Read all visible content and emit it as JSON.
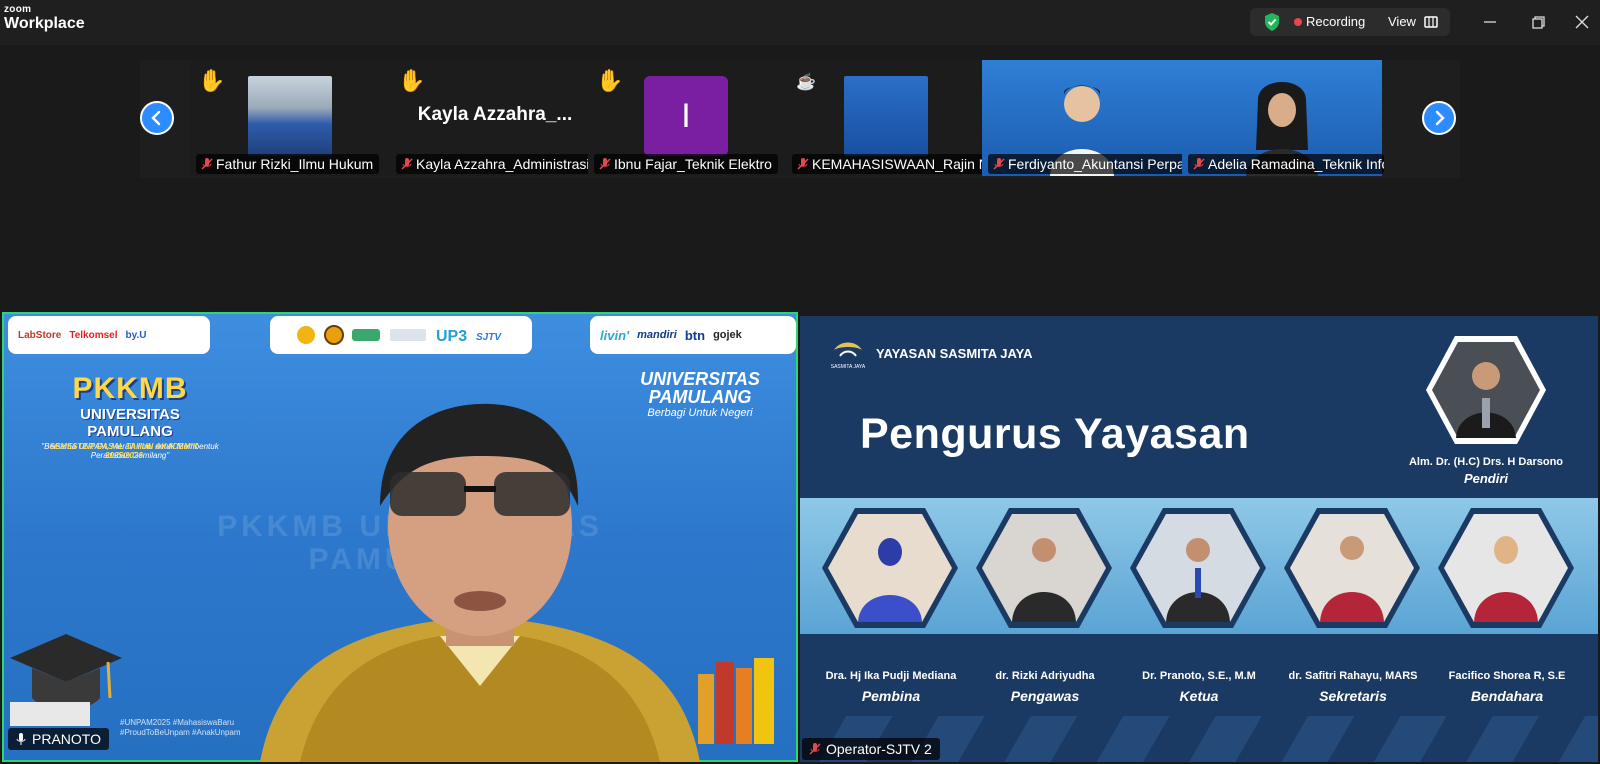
{
  "app": {
    "brand_small": "zoom",
    "brand_large": "Workplace",
    "recording_label": "Recording",
    "view_label": "View"
  },
  "colors": {
    "accent": "#2d8cff",
    "recording": "#e5484d",
    "active_speaker": "#2ed573",
    "raised_hand": "#f5c542",
    "avatar_purple": "#7b1fa2"
  },
  "participants": [
    {
      "name": "Fathur Rizki_Ilmu Hukum",
      "status_icon": "raised-hand-icon",
      "tile_type": "photo"
    },
    {
      "name": "Kayla Azzahra_Administrasi ...",
      "display": "Kayla  Azzahra_...",
      "status_icon": "raised-hand-icon",
      "tile_type": "name"
    },
    {
      "name": "Ibnu Fajar_Teknik Elektro",
      "initial": "I",
      "status_icon": "raised-hand-icon",
      "tile_type": "initial"
    },
    {
      "name": "KEMAHASISWAAN_Rajin Na...",
      "status_icon": "coffee-icon",
      "tile_type": "slide"
    },
    {
      "name": "Ferdiyanto_Akuntansi Perpaj...",
      "tile_type": "video"
    },
    {
      "name": "Adelia Ramadina_Teknik Info...",
      "tile_type": "video"
    }
  ],
  "main_left": {
    "participant": "PRANOTO",
    "sponsors_left": [
      "LabStore",
      "Telkomsel",
      "by.U"
    ],
    "sponsors_right": [
      "livin'",
      "mandiri",
      "btn",
      "gojek"
    ],
    "pkkmb_title": "PKKMB",
    "pkkmb_university": "UNIVERSITAS PAMULANG",
    "pkkmb_tagline": "\"Bersama UNPAM, Meraih Ilmu untuk Membentuk Peradaban Gemilang\"",
    "semester": "SEMESTER GASAL TAHUN AKADEMIK 2025/2026",
    "brand_title": "UNIVERSITAS PAMULANG",
    "brand_tagline": "Berbagi Untuk Negeri",
    "watermark": "PKKMB UNIVERSITAS PAMULANG",
    "hashtags": "#UNPAM2025 #MahasiswaBaru #ProudToBeUnpam #AnakUnpam"
  },
  "main_right": {
    "participant": "Operator-SJTV 2",
    "org_name": "YAYASAN SASMITA JAYA",
    "org_logo_caption": "SASMITA JAYA",
    "slide_title": "Pengurus Yayasan",
    "founder": {
      "name": "Alm. Dr. (H.C) Drs. H Darsono",
      "role": "Pendiri"
    },
    "members": [
      {
        "name": "Dra. Hj Ika Pudji Mediana",
        "role": "Pembina",
        "color": "#3a4fc9"
      },
      {
        "name": "dr. Rizki Adriyudha",
        "role": "Pengawas",
        "color": "#2a2a2a"
      },
      {
        "name": "Dr. Pranoto, S.E., M.M",
        "role": "Ketua",
        "color": "#2a2a2a"
      },
      {
        "name": "dr. Safitri Rahayu, MARS",
        "role": "Sekretaris",
        "color": "#b5253a"
      },
      {
        "name": "Facifico Shorea R, S.E",
        "role": "Bendahara",
        "color": "#b5253a"
      }
    ]
  }
}
